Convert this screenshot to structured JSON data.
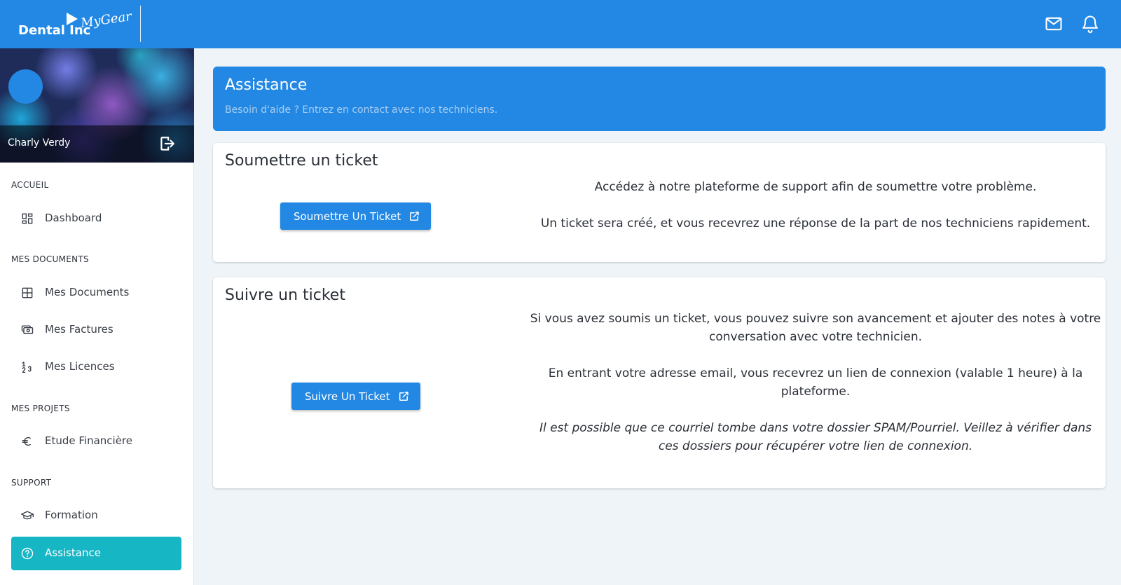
{
  "brand": {
    "name": "Dental Inc",
    "sub": "MyGear"
  },
  "topbar": {
    "icons": [
      "mail-icon",
      "bell-icon"
    ]
  },
  "profile": {
    "name": "Charly Verdy"
  },
  "sidebar": {
    "sections": [
      {
        "title": "ACCUEIL",
        "items": [
          {
            "label": "Dashboard",
            "icon": "dashboard-icon"
          }
        ]
      },
      {
        "title": "MES DOCUMENTS",
        "items": [
          {
            "label": "Mes Documents",
            "icon": "grid-icon"
          },
          {
            "label": "Mes Factures",
            "icon": "cash-icon"
          },
          {
            "label": "Mes Licences",
            "icon": "numbers-icon"
          }
        ]
      },
      {
        "title": "MES PROJETS",
        "items": [
          {
            "label": "Etude Financière",
            "icon": "euro-icon"
          }
        ]
      },
      {
        "title": "SUPPORT",
        "items": [
          {
            "label": "Formation",
            "icon": "graduation-cap-icon"
          },
          {
            "label": "Assistance",
            "icon": "help-circle-icon",
            "active": true
          }
        ]
      }
    ]
  },
  "header": {
    "title": "Assistance",
    "subtitle": "Besoin d'aide ? Entrez en contact avec nos techniciens."
  },
  "submit_card": {
    "title": "Soumettre un ticket",
    "button": "Soumettre Un Ticket",
    "paragraphs": [
      "Accédez à notre plateforme de support afin de soumettre votre problème.",
      "Un ticket sera créé, et vous recevrez une réponse de la part de nos techniciens rapidement."
    ]
  },
  "follow_card": {
    "title": "Suivre un ticket",
    "button": "Suivre Un Ticket",
    "paragraphs": [
      "Si vous avez soumis un ticket, vous pouvez suivre son avancement et ajouter des notes à votre conversation avec votre technicien.",
      "En entrant votre adresse email, vous recevrez un lien de connexion (valable 1 heure) à la plateforme.",
      "Il est possible que ce courriel tombe dans votre dossier SPAM/Pourriel. Veillez à vérifier dans ces dossiers pour récupérer votre lien de connexion."
    ]
  },
  "colors": {
    "primary": "#2388e3",
    "active": "#16b6c4",
    "background": "#eef4f8"
  }
}
